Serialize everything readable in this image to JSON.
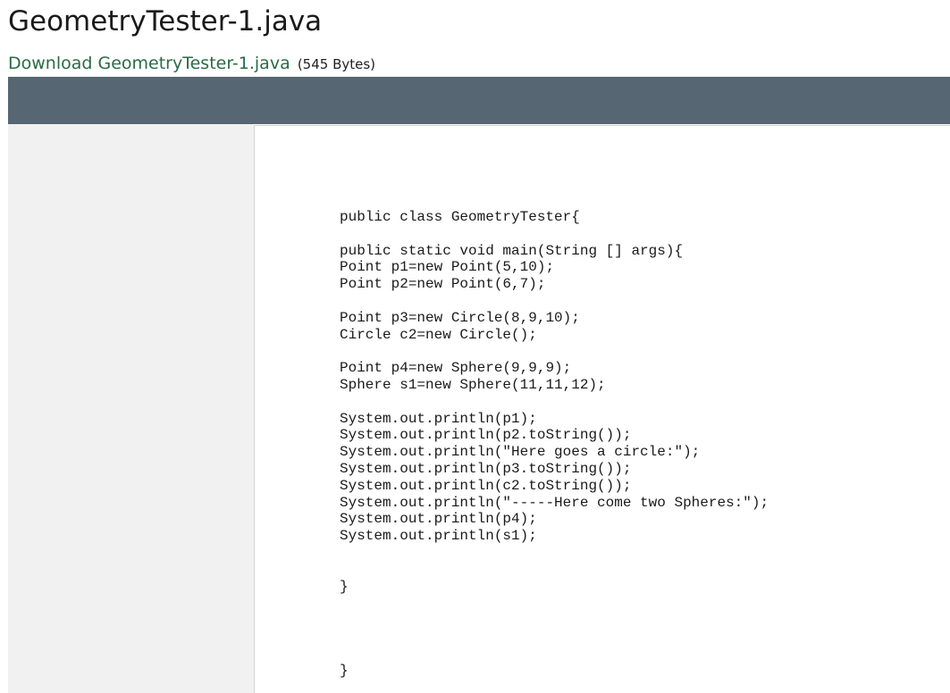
{
  "header": {
    "title": "GeometryTester-1.java",
    "download_label": "Download GeometryTester-1.java",
    "file_size": "(545 Bytes)"
  },
  "colors": {
    "toolbar": "#566672",
    "sidebar": "#f1f1f1",
    "link": "#2a6b46"
  },
  "code": {
    "lines": [
      "public class GeometryTester{",
      "",
      "public static void main(String [] args){",
      "Point p1=new Point(5,10);",
      "Point p2=new Point(6,7);",
      "",
      "Point p3=new Circle(8,9,10);",
      "Circle c2=new Circle();",
      "",
      "Point p4=new Sphere(9,9,9);",
      "Sphere s1=new Sphere(11,11,12);",
      "",
      "System.out.println(p1);",
      "System.out.println(p2.toString());",
      "System.out.println(\"Here goes a circle:\");",
      "System.out.println(p3.toString());",
      "System.out.println(c2.toString());",
      "System.out.println(\"-----Here come two Spheres:\");",
      "System.out.println(p4);",
      "System.out.println(s1);",
      "",
      "",
      "}",
      "",
      "",
      "",
      "",
      "}"
    ]
  }
}
